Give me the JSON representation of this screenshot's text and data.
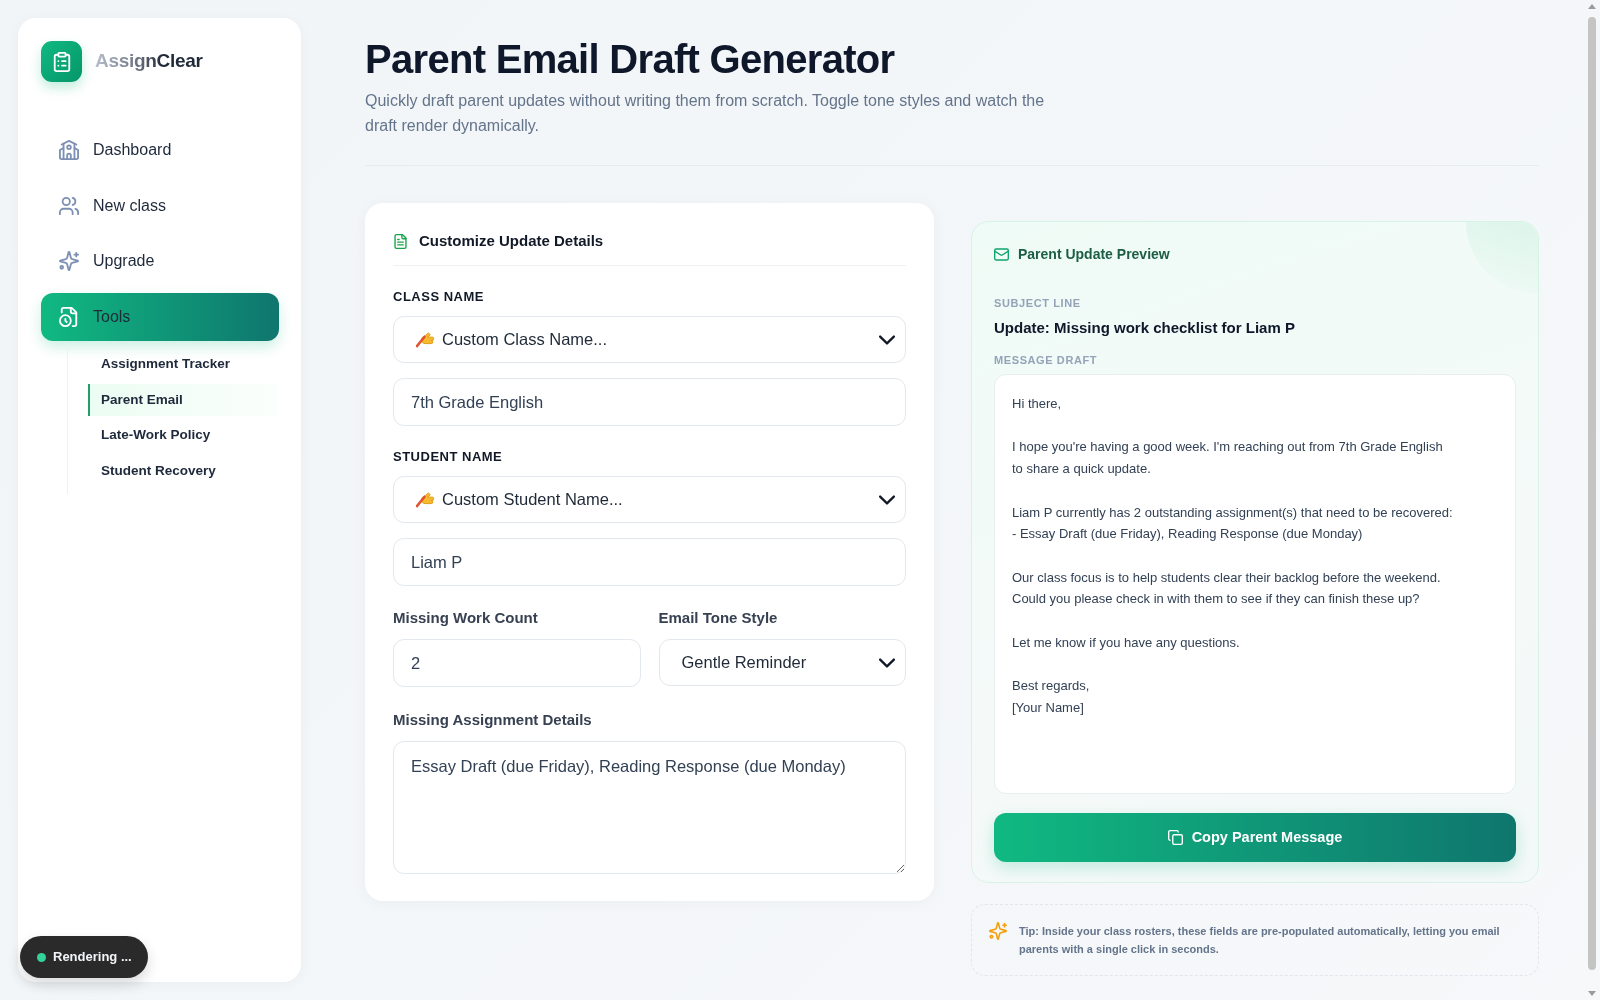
{
  "sidebar": {
    "logo_text": "AssignClear",
    "items": [
      {
        "label": "Dashboard",
        "selected": false
      },
      {
        "label": "New class",
        "selected": false
      },
      {
        "label": "Upgrade",
        "selected": false
      },
      {
        "label": "Tools",
        "selected": true,
        "children": [
          {
            "label": "Assignment Tracker",
            "selected": false
          },
          {
            "label": "Parent Email",
            "selected": true
          },
          {
            "label": "Late-Work Policy",
            "selected": false
          },
          {
            "label": "Student Recovery",
            "selected": false
          }
        ]
      }
    ]
  },
  "header": {
    "title": "Parent Email Draft Generator",
    "subtitle": "Quickly draft parent updates without writing them from scratch. Toggle tone styles and watch the draft render dynamically."
  },
  "form": {
    "title": "Customize Update Details",
    "class_name": {
      "label": "CLASS NAME",
      "select_value": "Custom Class Name...",
      "input_value": "7th Grade English"
    },
    "student_name": {
      "label": "STUDENT NAME",
      "select_value": "Custom Student Name...",
      "input_value": "Liam P"
    },
    "missing_count": {
      "label": "Missing Work Count",
      "value": "2"
    },
    "tone": {
      "label": "Email Tone Style",
      "value": "Gentle Reminder"
    },
    "details": {
      "label": "Missing Assignment Details",
      "value": "Essay Draft (due Friday), Reading Response (due Monday)"
    }
  },
  "preview": {
    "title": "Parent Update Preview",
    "subject_label": "SUBJECT LINE",
    "subject": "Update: Missing work checklist for Liam P",
    "message_label": "MESSAGE DRAFT",
    "message": "Hi there,\n\nI hope you're having a good week. I'm reaching out from 7th Grade English\nto share a quick update.\n\nLiam P currently has 2 outstanding assignment(s) that need to be recovered:\n- Essay Draft (due Friday), Reading Response (due Monday)\n\nOur class focus is to help students clear their backlog before the weekend.\nCould you please check in with them to see if they can finish these up?\n\nLet me know if you have any questions.\n\nBest regards,\n[Your Name]",
    "copy_button": "Copy Parent Message"
  },
  "tip": "Tip: Inside your class rosters, these fields are pre-populated automatically, letting you email parents with a single click in seconds.",
  "status_toast": {
    "text": "Rendering ..."
  }
}
